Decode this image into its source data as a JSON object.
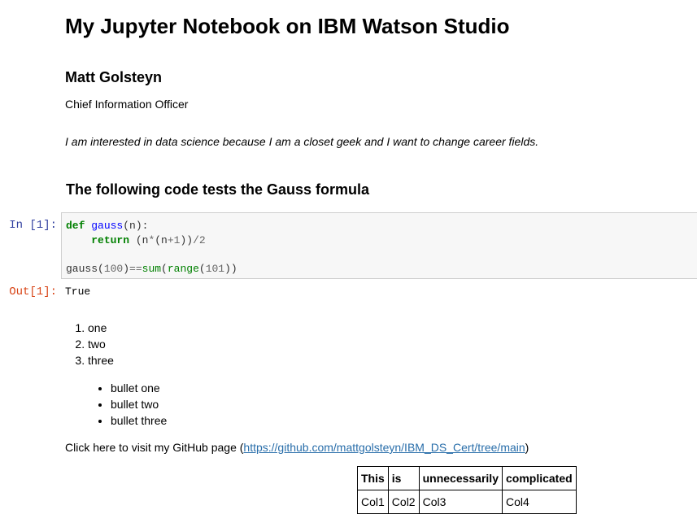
{
  "notebook": {
    "title": "My Jupyter Notebook on IBM Watson Studio",
    "author": "Matt Golsteyn",
    "role": "Chief Information Officer",
    "interest": "I am interested in data science because I am a closet geek and I want to change career fields.",
    "section_heading": "The following code tests the Gauss formula"
  },
  "code_cell": {
    "in_prompt": "In [1]:",
    "lines": [
      "def gauss(n):",
      "    return (n*(n+1))/2",
      "",
      "gauss(100)==sum(range(101))"
    ],
    "out_prompt": "Out[1]:",
    "output": "True"
  },
  "numbered_list": [
    "one",
    "two",
    "three"
  ],
  "bullet_list": [
    "bullet one",
    "bullet two",
    "bullet three"
  ],
  "github": {
    "prefix": "Click here to visit my GitHub page (",
    "link_text": "https://github.com/mattgolsteyn/IBM_DS_Cert/tree/main",
    "suffix": ")"
  },
  "table": {
    "headers": [
      "This",
      "is",
      "unnecessarily",
      "complicated"
    ],
    "rows": [
      [
        "Col1",
        "Col2",
        "Col3",
        "Col4"
      ]
    ]
  }
}
